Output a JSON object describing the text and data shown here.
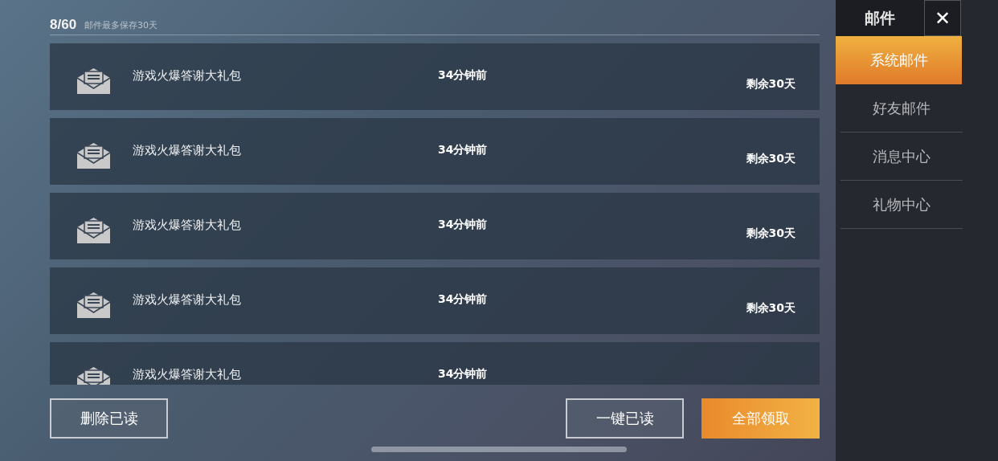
{
  "header": {
    "count": "8/60",
    "note": "邮件最多保存30天"
  },
  "mails": [
    {
      "title": "游戏火爆答谢大礼包",
      "time": "34分钟前",
      "expiry": "剩余30天"
    },
    {
      "title": "游戏火爆答谢大礼包",
      "time": "34分钟前",
      "expiry": "剩余30天"
    },
    {
      "title": "游戏火爆答谢大礼包",
      "time": "34分钟前",
      "expiry": "剩余30天"
    },
    {
      "title": "游戏火爆答谢大礼包",
      "time": "34分钟前",
      "expiry": "剩余30天"
    },
    {
      "title": "游戏火爆答谢大礼包",
      "time": "34分钟前"
    }
  ],
  "buttons": [
    {
      "label": "删除已读",
      "kind": "outline"
    },
    {
      "label": "一键已读",
      "kind": "outline"
    },
    {
      "label": "全部领取",
      "kind": "primary"
    }
  ],
  "sidebar": {
    "title": "邮件",
    "close": "✕",
    "items": [
      {
        "label": "系统邮件",
        "selected": true
      },
      {
        "label": "好友邮件",
        "selected": false
      },
      {
        "label": "消息中心",
        "selected": false
      },
      {
        "label": "礼物中心",
        "selected": false
      }
    ]
  }
}
